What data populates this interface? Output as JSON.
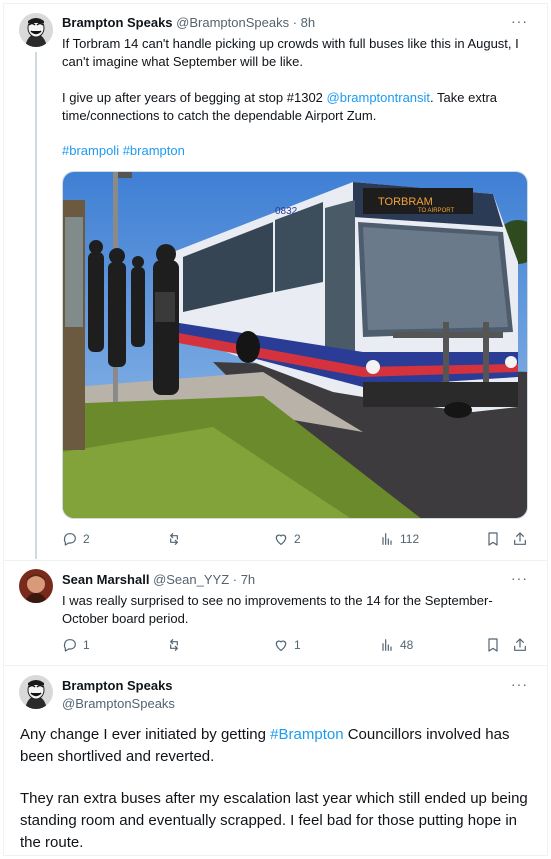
{
  "tweets": [
    {
      "name": "Brampton Speaks",
      "handle": "@BramptonSpeaks",
      "time": "· 8h",
      "line1": "If Torbram 14 can't handle picking up crowds with full buses like this in August, I can't imagine what September will be like.",
      "line2_pre": "I give up after years of begging at stop #1302 ",
      "line2_mention": "@bramptontransit",
      "line2_post": ". Take extra time/connections to catch the dependable Airport Zum.",
      "hashtags": "#brampoli #brampton",
      "image_sign": "TORBRAM",
      "image_sign_sub": "TO AIRPORT",
      "image_number": "0832",
      "replies": "2",
      "reposts": "",
      "likes": "2",
      "views": "112"
    },
    {
      "name": "Sean Marshall",
      "handle": "@Sean_YYZ",
      "time": "· 7h",
      "text": "I was really surprised to see no improvements to the 14 for the September-October board period.",
      "replies": "1",
      "reposts": "",
      "likes": "1",
      "views": "48"
    },
    {
      "name": "Brampton Speaks",
      "handle": "@BramptonSpeaks",
      "p1_pre": "Any change I ever initiated by getting ",
      "p1_tag": "#Brampton",
      "p1_post": " Councillors involved has been shortlived and reverted.",
      "p2": "They ran extra buses after my escalation last year which still ended up being standing room and eventually scrapped. I feel bad for those putting hope in the route."
    }
  ],
  "more_label": "···",
  "colors": {
    "link": "#1d9bf0",
    "muted": "#536471",
    "line": "#cfd9de"
  },
  "icons": [
    "reply-icon",
    "repost-icon",
    "like-icon",
    "views-icon",
    "bookmark-icon",
    "share-icon",
    "more-icon"
  ]
}
